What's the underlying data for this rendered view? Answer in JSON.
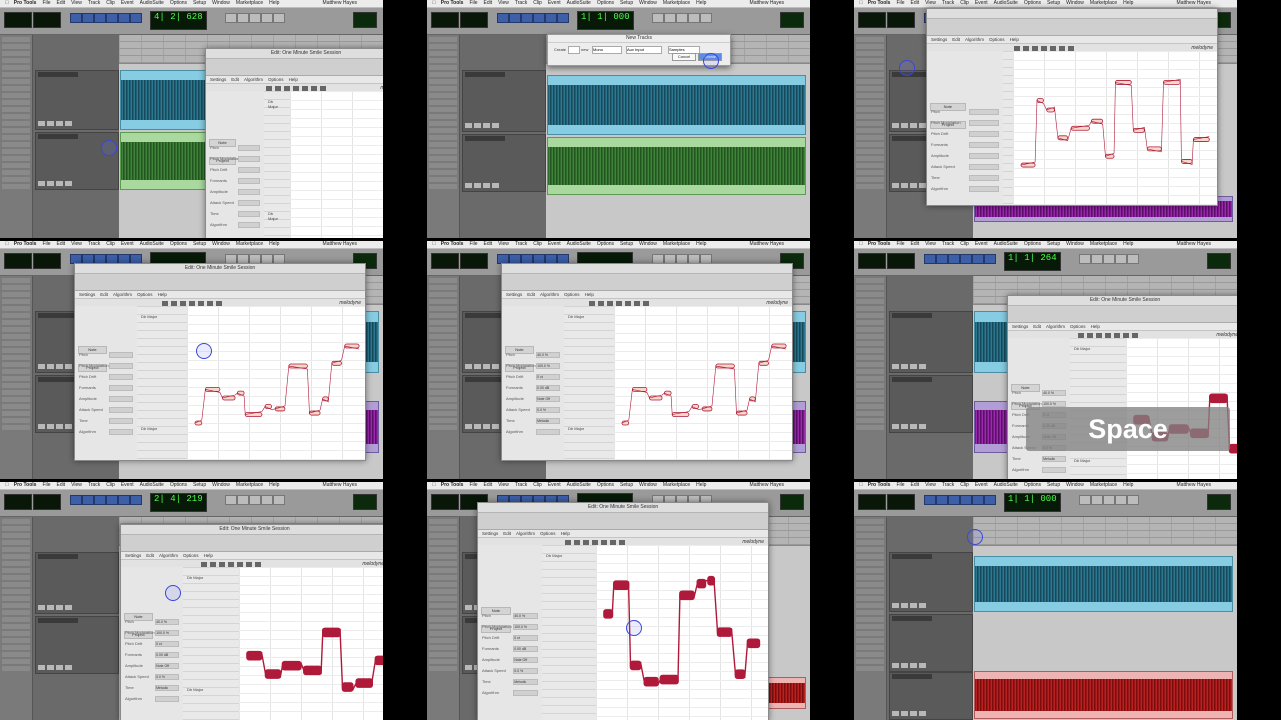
{
  "menu": {
    "app": "Pro Tools",
    "items": [
      "File",
      "Edit",
      "View",
      "Track",
      "Clip",
      "Event",
      "AudioSuite",
      "Options",
      "Setup",
      "Window",
      "Marketplace",
      "Help"
    ],
    "user": "Matthew Hayes"
  },
  "frames": [
    {
      "counter": "4| 2| 628",
      "window_title": "Edit: One Minute Smile Session",
      "layout": "melodyne-empty"
    },
    {
      "counter": "1| 1| 000",
      "window_title": "Edit: One Minute Smile Session",
      "layout": "new-tracks"
    },
    {
      "counter": "",
      "window_title": "",
      "layout": "melodyne-notes"
    },
    {
      "counter": "",
      "window_title": "Edit: One Minute Smile Session",
      "layout": "melodyne-notes-scale"
    },
    {
      "counter": "",
      "window_title": "",
      "layout": "melodyne-notes-scale"
    },
    {
      "counter": "1| 1| 264",
      "window_title": "Edit: One Minute Smile Session",
      "layout": "melodyne-blobs-space"
    },
    {
      "counter": "2| 4| 219",
      "window_title": "Edit: One Minute Smile Session",
      "layout": "melodyne-blobs"
    },
    {
      "counter": "",
      "window_title": "Edit: One Minute Smile Session",
      "layout": "melodyne-blobs-small"
    },
    {
      "counter": "1| 1| 000",
      "window_title": "Edit: One Minute Smile Session",
      "layout": "tracks-only"
    }
  ],
  "dialog": {
    "title": "New Tracks",
    "create_label": "Create",
    "new_label": "new",
    "format": "Mono",
    "type": "Aux Input",
    "timebase": "Samples",
    "cancel": "Cancel",
    "create": "Create"
  },
  "melodyne": {
    "logo": "melodyne",
    "menus": [
      "Settings",
      "Edit",
      "Algorithm",
      "Options",
      "Help"
    ],
    "tab_note": "Note",
    "tab_project": "Project",
    "scale_tag": "Db Major",
    "inspector_labels": [
      "Pitch",
      "Pitch Modulation",
      "Pitch Drift",
      "Formants",
      "Amplitude",
      "Attack Speed",
      "Time",
      "Algorithm"
    ],
    "inspector_values": [
      "40.0 %",
      "100.0 %",
      "0 ct",
      "0.00 dB",
      "Note Off",
      "0.0 %",
      "Melodic"
    ]
  },
  "overlay": {
    "text": "Space"
  },
  "colors": {
    "clip_blue": "#86cce2",
    "clip_green": "#a9d99e",
    "clip_purple": "#b29ed6",
    "clip_red": "#eeb4b4",
    "blob_red": "#b01a3a",
    "cursor_ring": "#3a47d8"
  }
}
